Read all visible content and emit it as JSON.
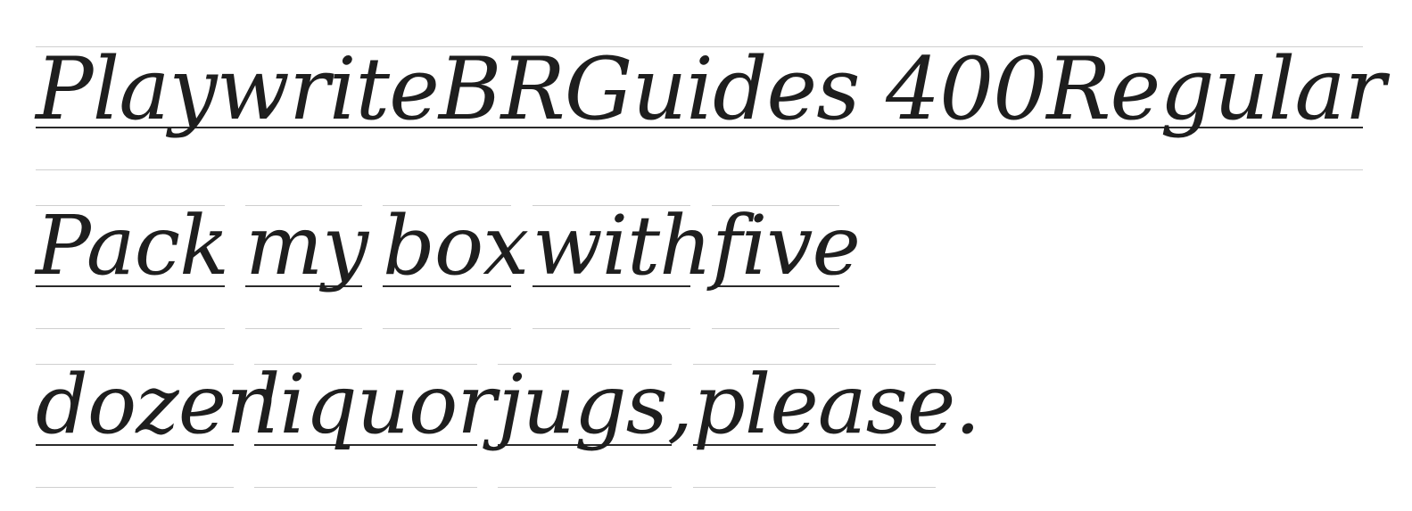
{
  "specimen": {
    "title": "PlaywriteBRGuides 400Regular",
    "line1": [
      "Pack",
      "my",
      "box",
      "with",
      "five"
    ],
    "line2": [
      "dozen",
      "liquor",
      "jugs,",
      "please."
    ]
  },
  "colors": {
    "ink": "#1e1e1e",
    "guide_line": "#cfcfcf",
    "baseline": "#2a2a2a",
    "background": "#ffffff"
  }
}
